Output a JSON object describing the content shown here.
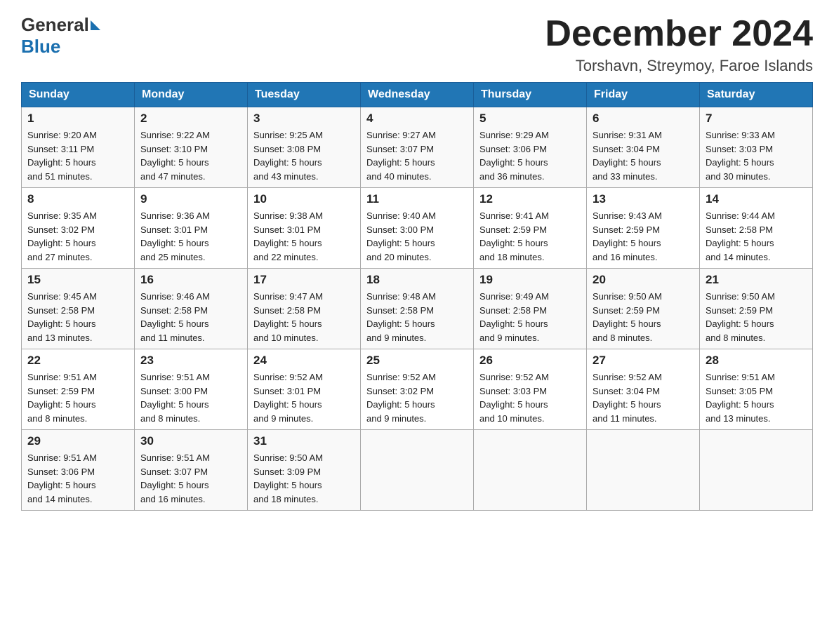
{
  "logo": {
    "general": "General",
    "blue": "Blue"
  },
  "header": {
    "month": "December 2024",
    "location": "Torshavn, Streymoy, Faroe Islands"
  },
  "weekdays": [
    "Sunday",
    "Monday",
    "Tuesday",
    "Wednesday",
    "Thursday",
    "Friday",
    "Saturday"
  ],
  "weeks": [
    [
      {
        "day": "1",
        "sunrise": "9:20 AM",
        "sunset": "3:11 PM",
        "daylight": "5 hours and 51 minutes."
      },
      {
        "day": "2",
        "sunrise": "9:22 AM",
        "sunset": "3:10 PM",
        "daylight": "5 hours and 47 minutes."
      },
      {
        "day": "3",
        "sunrise": "9:25 AM",
        "sunset": "3:08 PM",
        "daylight": "5 hours and 43 minutes."
      },
      {
        "day": "4",
        "sunrise": "9:27 AM",
        "sunset": "3:07 PM",
        "daylight": "5 hours and 40 minutes."
      },
      {
        "day": "5",
        "sunrise": "9:29 AM",
        "sunset": "3:06 PM",
        "daylight": "5 hours and 36 minutes."
      },
      {
        "day": "6",
        "sunrise": "9:31 AM",
        "sunset": "3:04 PM",
        "daylight": "5 hours and 33 minutes."
      },
      {
        "day": "7",
        "sunrise": "9:33 AM",
        "sunset": "3:03 PM",
        "daylight": "5 hours and 30 minutes."
      }
    ],
    [
      {
        "day": "8",
        "sunrise": "9:35 AM",
        "sunset": "3:02 PM",
        "daylight": "5 hours and 27 minutes."
      },
      {
        "day": "9",
        "sunrise": "9:36 AM",
        "sunset": "3:01 PM",
        "daylight": "5 hours and 25 minutes."
      },
      {
        "day": "10",
        "sunrise": "9:38 AM",
        "sunset": "3:01 PM",
        "daylight": "5 hours and 22 minutes."
      },
      {
        "day": "11",
        "sunrise": "9:40 AM",
        "sunset": "3:00 PM",
        "daylight": "5 hours and 20 minutes."
      },
      {
        "day": "12",
        "sunrise": "9:41 AM",
        "sunset": "2:59 PM",
        "daylight": "5 hours and 18 minutes."
      },
      {
        "day": "13",
        "sunrise": "9:43 AM",
        "sunset": "2:59 PM",
        "daylight": "5 hours and 16 minutes."
      },
      {
        "day": "14",
        "sunrise": "9:44 AM",
        "sunset": "2:58 PM",
        "daylight": "5 hours and 14 minutes."
      }
    ],
    [
      {
        "day": "15",
        "sunrise": "9:45 AM",
        "sunset": "2:58 PM",
        "daylight": "5 hours and 13 minutes."
      },
      {
        "day": "16",
        "sunrise": "9:46 AM",
        "sunset": "2:58 PM",
        "daylight": "5 hours and 11 minutes."
      },
      {
        "day": "17",
        "sunrise": "9:47 AM",
        "sunset": "2:58 PM",
        "daylight": "5 hours and 10 minutes."
      },
      {
        "day": "18",
        "sunrise": "9:48 AM",
        "sunset": "2:58 PM",
        "daylight": "5 hours and 9 minutes."
      },
      {
        "day": "19",
        "sunrise": "9:49 AM",
        "sunset": "2:58 PM",
        "daylight": "5 hours and 9 minutes."
      },
      {
        "day": "20",
        "sunrise": "9:50 AM",
        "sunset": "2:59 PM",
        "daylight": "5 hours and 8 minutes."
      },
      {
        "day": "21",
        "sunrise": "9:50 AM",
        "sunset": "2:59 PM",
        "daylight": "5 hours and 8 minutes."
      }
    ],
    [
      {
        "day": "22",
        "sunrise": "9:51 AM",
        "sunset": "2:59 PM",
        "daylight": "5 hours and 8 minutes."
      },
      {
        "day": "23",
        "sunrise": "9:51 AM",
        "sunset": "3:00 PM",
        "daylight": "5 hours and 8 minutes."
      },
      {
        "day": "24",
        "sunrise": "9:52 AM",
        "sunset": "3:01 PM",
        "daylight": "5 hours and 9 minutes."
      },
      {
        "day": "25",
        "sunrise": "9:52 AM",
        "sunset": "3:02 PM",
        "daylight": "5 hours and 9 minutes."
      },
      {
        "day": "26",
        "sunrise": "9:52 AM",
        "sunset": "3:03 PM",
        "daylight": "5 hours and 10 minutes."
      },
      {
        "day": "27",
        "sunrise": "9:52 AM",
        "sunset": "3:04 PM",
        "daylight": "5 hours and 11 minutes."
      },
      {
        "day": "28",
        "sunrise": "9:51 AM",
        "sunset": "3:05 PM",
        "daylight": "5 hours and 13 minutes."
      }
    ],
    [
      {
        "day": "29",
        "sunrise": "9:51 AM",
        "sunset": "3:06 PM",
        "daylight": "5 hours and 14 minutes."
      },
      {
        "day": "30",
        "sunrise": "9:51 AM",
        "sunset": "3:07 PM",
        "daylight": "5 hours and 16 minutes."
      },
      {
        "day": "31",
        "sunrise": "9:50 AM",
        "sunset": "3:09 PM",
        "daylight": "5 hours and 18 minutes."
      },
      null,
      null,
      null,
      null
    ]
  ],
  "labels": {
    "sunrise": "Sunrise:",
    "sunset": "Sunset:",
    "daylight": "Daylight:"
  }
}
